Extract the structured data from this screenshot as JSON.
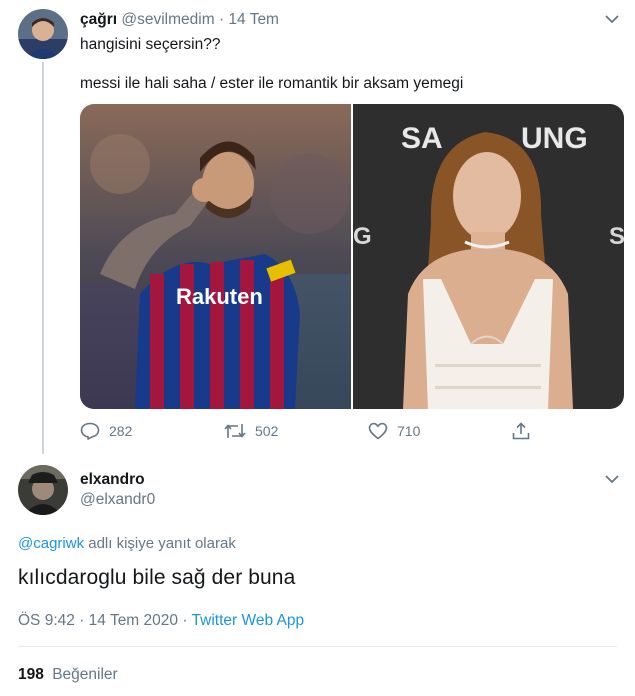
{
  "tweet1": {
    "display_name": "çağrı",
    "handle": "@sevilmedim",
    "separator": "·",
    "date": "14 Tem",
    "line1": "hangisini seçersin??",
    "line2": "messi ile hali saha / ester ile romantik bir aksam yemegi",
    "actions": {
      "replies": "282",
      "retweets": "502",
      "likes": "710"
    }
  },
  "tweet2": {
    "display_name": "elxandro",
    "handle": "@elxandr0",
    "reply_mention": "@cagriwk",
    "reply_suffix": "adlı kişiye yanıt olarak",
    "text": "kılıcdaroglu bile sağ der buna",
    "time": "ÖS 9:42",
    "meta_sep": "·",
    "date": "14 Tem 2020",
    "source": "Twitter Web App",
    "likes_count": "198",
    "likes_label": "Beğeniler"
  },
  "colors": {
    "link": "#1b95e0",
    "muted": "#657786",
    "text": "#14171a",
    "border": "#e6ecf0"
  },
  "icons": [
    "chevron-down-icon",
    "reply-icon",
    "retweet-icon",
    "heart-icon",
    "share-icon"
  ]
}
